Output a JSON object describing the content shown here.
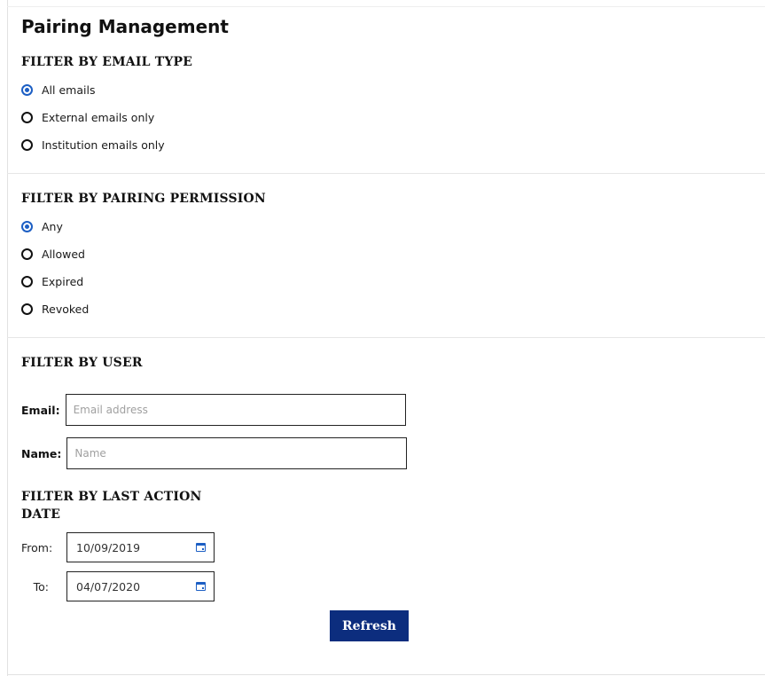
{
  "page_title": "Pairing Management",
  "email_type_filter": {
    "heading": "FILTER BY EMAIL TYPE",
    "options": [
      {
        "label": "All emails",
        "checked": true
      },
      {
        "label": "External emails only",
        "checked": false
      },
      {
        "label": "Institution emails only",
        "checked": false
      }
    ]
  },
  "pairing_permission_filter": {
    "heading": "FILTER BY PAIRING PERMISSION",
    "options": [
      {
        "label": "Any",
        "checked": true
      },
      {
        "label": "Allowed",
        "checked": false
      },
      {
        "label": "Expired",
        "checked": false
      },
      {
        "label": "Revoked",
        "checked": false
      }
    ]
  },
  "user_filter": {
    "heading": "FILTER BY USER",
    "email_label": "Email:",
    "email_placeholder": "Email address",
    "email_value": "",
    "name_label": "Name:",
    "name_placeholder": "Name",
    "name_value": ""
  },
  "last_action_filter": {
    "heading": "FILTER BY LAST ACTION DATE",
    "from_label": "From:",
    "from_value": "10/09/2019",
    "to_label": "To:",
    "to_value": "04/07/2020"
  },
  "refresh_label": "Refresh",
  "colors": {
    "accent": "#1d5fc4",
    "button_bg": "#0c2d7e"
  }
}
